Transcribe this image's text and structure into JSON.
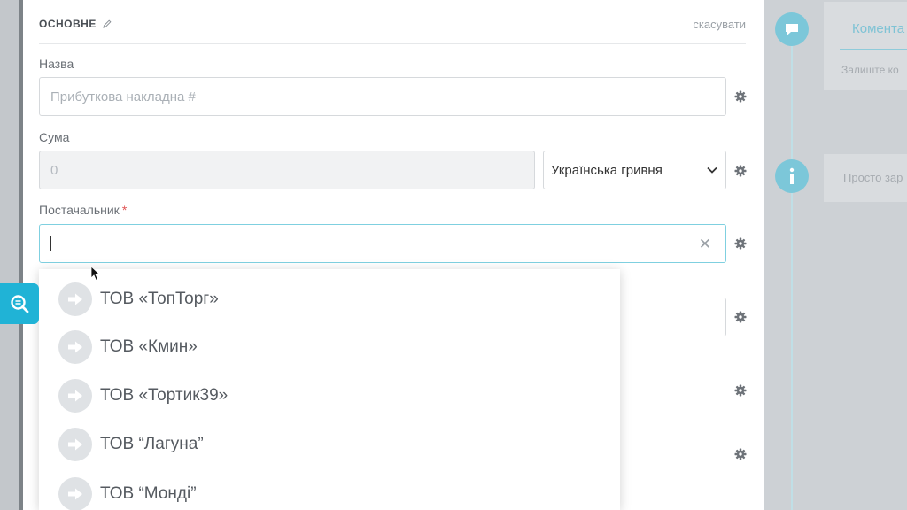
{
  "form": {
    "section_title": "ОСНОВНЕ",
    "cancel_label": "скасувати",
    "name": {
      "label": "Назва",
      "placeholder": "Прибуткова накладна #"
    },
    "sum": {
      "label": "Сума",
      "value": "0",
      "currency": "Українська гривня"
    },
    "supplier": {
      "label": "Постачальник",
      "required_mark": "*",
      "value": ""
    }
  },
  "supplier_options": [
    {
      "label": "ТОВ «ТопТорг»"
    },
    {
      "label": "ТОВ «Кмин»"
    },
    {
      "label": "ТОВ «Тортик39»"
    },
    {
      "label": "ТОВ “Лагуна”"
    },
    {
      "label": "ТОВ “Монді”"
    }
  ],
  "sidebar": {
    "comment_tab": "Комента",
    "comment_hint": "Залиште ко",
    "info_text": "Просто зар"
  },
  "colors": {
    "accent": "#20b3d6",
    "focus_border": "#7fd0e0",
    "timeline_icon": "#7cc7d9"
  }
}
